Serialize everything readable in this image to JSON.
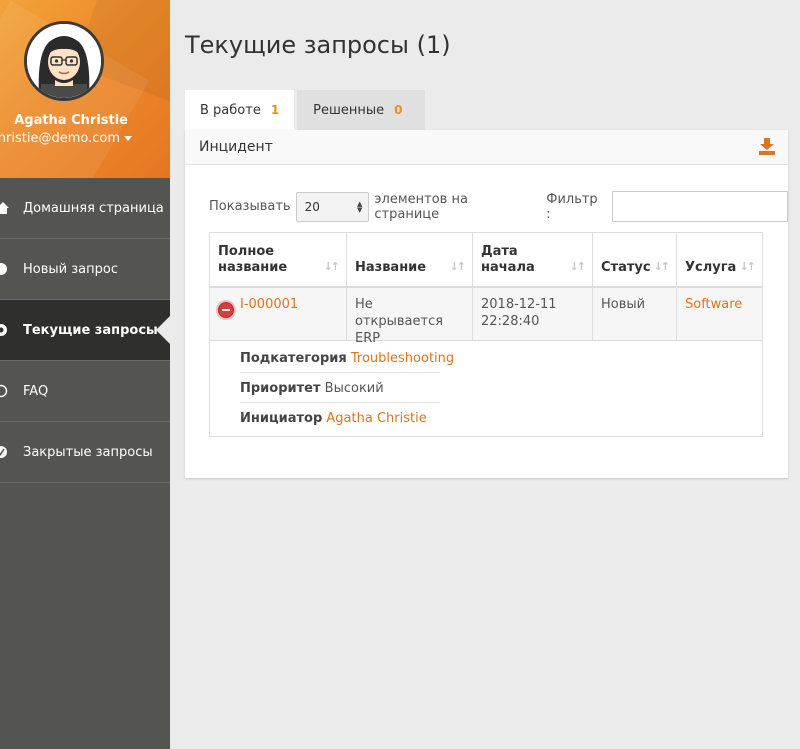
{
  "profile": {
    "name": "Agatha Christie",
    "email": "christie@demo.com"
  },
  "nav": {
    "items": [
      {
        "label": "Домашняя страница",
        "icon": "home-icon"
      },
      {
        "label": "Новый запрос",
        "icon": "new-request-icon"
      },
      {
        "label": "Текущие запросы",
        "icon": "current-requests-icon",
        "active": true
      },
      {
        "label": "FAQ",
        "icon": "faq-icon"
      },
      {
        "label": "Закрытые запросы",
        "icon": "closed-requests-icon"
      }
    ]
  },
  "page": {
    "title": "Текущие запросы (1)"
  },
  "tabs": [
    {
      "label": "В работе",
      "count": "1"
    },
    {
      "label": "Решенные",
      "count": "0"
    }
  ],
  "panel": {
    "title": "Инцидент",
    "download_icon": "download-icon"
  },
  "controls": {
    "show_label": "Показывать",
    "page_size": "20",
    "per_page_label": "элементов на странице",
    "filter_label": "Фильтр :",
    "filter_value": ""
  },
  "table": {
    "columns": [
      "Полное название",
      "Название",
      "Дата начала",
      "Статус",
      "Услуга"
    ],
    "rows": [
      {
        "id": "I-000001",
        "name": "Не открывается ERP",
        "date": "2018-12-11 22:28:40",
        "status": "Новый",
        "service": "Software"
      }
    ],
    "details": {
      "subcategory_label": "Подкатегория",
      "subcategory_value": "Troubleshooting",
      "priority_label": "Приоритет",
      "priority_value": "Высокий",
      "initiator_label": "Инициатор",
      "initiator_value": "Agatha Christie"
    }
  },
  "colors": {
    "accent": "#e0741d",
    "sidebar": "#545450",
    "sidebar_active": "#2f2f2d"
  }
}
